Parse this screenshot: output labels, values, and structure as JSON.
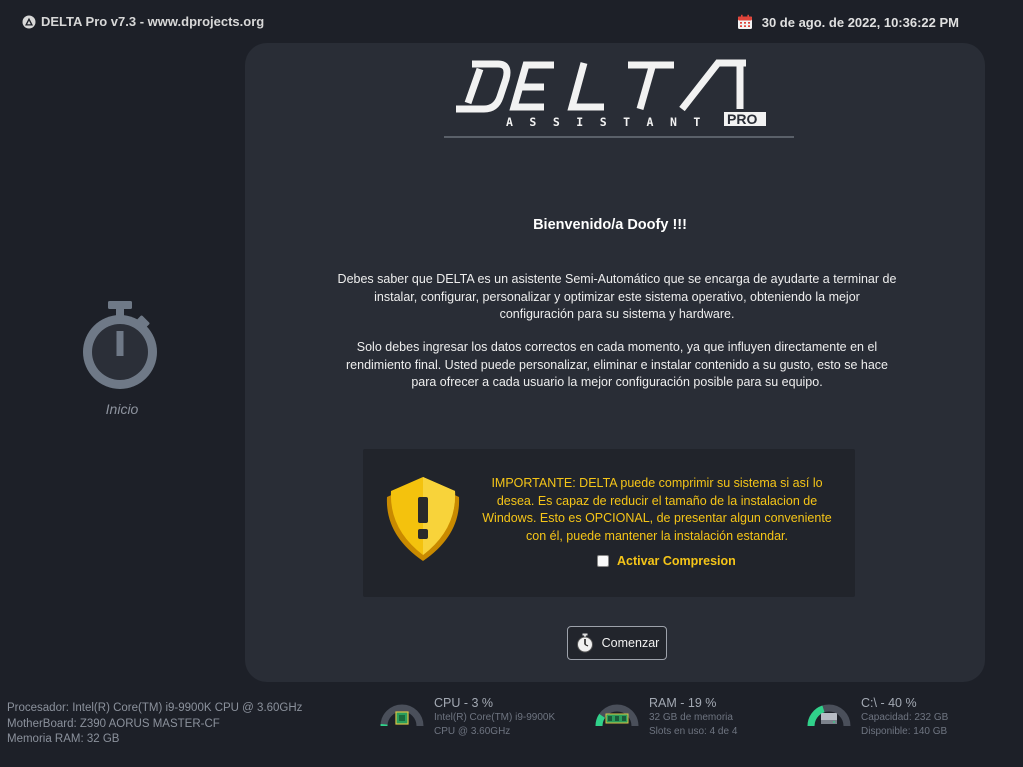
{
  "header": {
    "app_title": "DELTA Pro v7.3 - www.dprojects.org",
    "datetime": "30 de ago. de 2022, 10:36:22 PM"
  },
  "sidebar": {
    "items": [
      {
        "label": "Inicio",
        "icon": "stopwatch-icon"
      }
    ]
  },
  "logo": {
    "main": "DELTA",
    "sub": "ASSISTANT",
    "badge": "PRO"
  },
  "main": {
    "welcome": "Bienvenido/a Doofy !!!",
    "paragraph1": "Debes saber que DELTA es un asistente Semi-Automático que se encarga de ayudarte a terminar de instalar, configurar, personalizar y optimizar este sistema operativo, obteniendo la mejor configuración para su sistema y hardware.",
    "paragraph2": "Solo debes ingresar los datos correctos en cada momento, ya que influyen directamente en el rendimiento final. Usted puede personalizar, eliminar e instalar contenido a su gusto, esto se hace para ofrecer a cada usuario la mejor configuración posible para su equipo.",
    "warning": {
      "text": "IMPORTANTE: DELTA puede comprimir su sistema si así lo desea. Es capaz de reducir el tamaño de la instalacion de Windows. Esto es OPCIONAL, de presentar algun conveniente con él, puede mantener la instalación estandar.",
      "checkbox_label": "Activar Compresion",
      "checked": false
    },
    "start_button": "Comenzar"
  },
  "footer": {
    "processor": "Procesador: Intel(R) Core(TM) i9-9900K CPU @ 3.60GHz",
    "motherboard": "MotherBoard: Z390 AORUS MASTER-CF",
    "memory": "Memoria RAM: 32 GB",
    "gauges": [
      {
        "title": "CPU  - 3 %",
        "line1": "Intel(R) Core(TM) i9-9900K",
        "line2": "CPU @ 3.60GHz",
        "percent": 3,
        "icon": "cpu-chip-icon"
      },
      {
        "title": "RAM  - 19 %",
        "line1": "32 GB de memoria",
        "line2": "Slots en uso: 4 de 4",
        "percent": 19,
        "icon": "ram-module-icon"
      },
      {
        "title": "C:\\  - 40 %",
        "line1": "Capacidad: 232 GB",
        "line2": "Disponible: 140 GB",
        "percent": 40,
        "icon": "hard-drive-icon"
      }
    ]
  },
  "colors": {
    "background": "#1d2028",
    "panel": "#292d36",
    "accent_warning": "#f5c518",
    "gauge_fill": "#30d18a",
    "gauge_track": "#4a4f5a"
  }
}
